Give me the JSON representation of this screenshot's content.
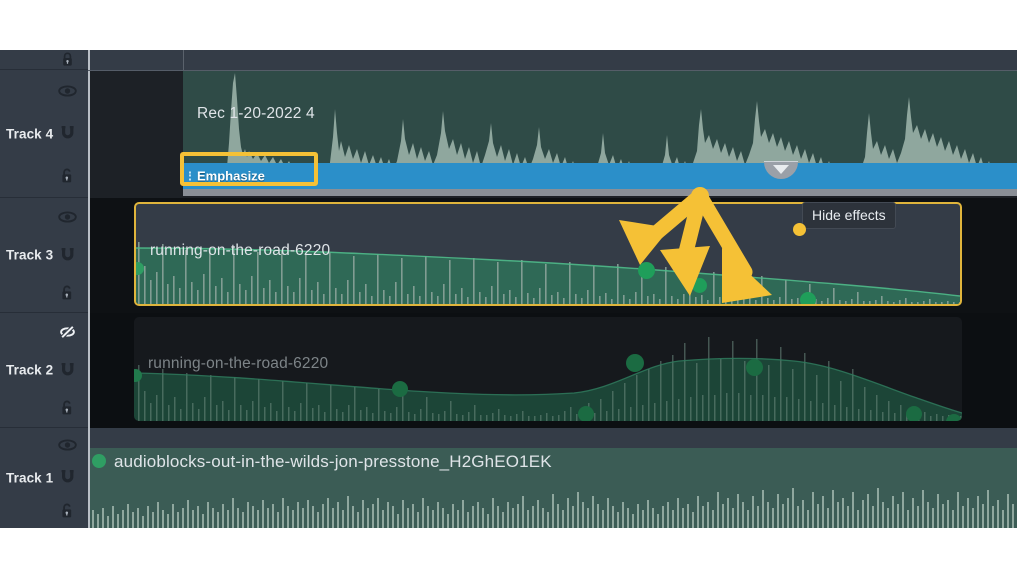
{
  "app": {
    "name": "audio-timeline-editor",
    "background": "#101316",
    "sidebar_bg": "#343c47"
  },
  "colors": {
    "selection": "#e0b53c",
    "highlight": "#f5c136",
    "effect_bar": "#2b8fc9",
    "keyframe": "#1f9e5a",
    "waveform": "#8fa79e",
    "clip_green": "#3b5c55",
    "clip_dark": "#343c47",
    "tooltip_bg": "#2d333b"
  },
  "sidebar": {
    "tracks": [
      {
        "name": "track-5-partial",
        "label": "",
        "visible_icon": "",
        "snap_icon": "",
        "lock_icon": "lock-closed-icon",
        "partial": true
      },
      {
        "name": "track-4",
        "label": "Track 4",
        "visible_icon": "eye-icon",
        "snap_icon": "magnet-icon",
        "lock_icon": "lock-open-icon",
        "hidden": false
      },
      {
        "name": "track-3",
        "label": "Track 3",
        "visible_icon": "eye-icon",
        "snap_icon": "magnet-icon",
        "lock_icon": "lock-open-icon",
        "hidden": false
      },
      {
        "name": "track-2",
        "label": "Track 2",
        "visible_icon": "eye-slash-icon",
        "snap_icon": "magnet-icon",
        "lock_icon": "lock-open-icon",
        "hidden": true
      },
      {
        "name": "track-1",
        "label": "Track 1",
        "visible_icon": "eye-icon",
        "snap_icon": "magnet-icon",
        "lock_icon": "lock-open-icon",
        "hidden": false
      }
    ]
  },
  "timeline": {
    "clips": [
      {
        "track": "Track 4",
        "label": "Rec 1-20-2022 4",
        "selected": false,
        "muted": false
      },
      {
        "track": "Track 3",
        "label": "running-on-the-road-6220",
        "selected": true,
        "muted": false
      },
      {
        "track": "Track 2",
        "label": "running-on-the-road-6220",
        "selected": false,
        "muted": true
      },
      {
        "track": "Track 1",
        "label": "audioblocks-out-in-the-wilds-jon-presstone_H2GhEO1EK",
        "selected": false,
        "muted": false
      }
    ]
  },
  "effects": {
    "bar_label": "Emphasize",
    "bar_color": "#2b8fc9",
    "highlighted": true,
    "collapse_icon": "chevron-down-icon"
  },
  "tooltip": {
    "text": "Hide effects",
    "dot_color": "#f5c136"
  },
  "annotations": {
    "arrow_color": "#f5c136",
    "arrow_count": 3,
    "origin_label": "arrow-origin"
  }
}
